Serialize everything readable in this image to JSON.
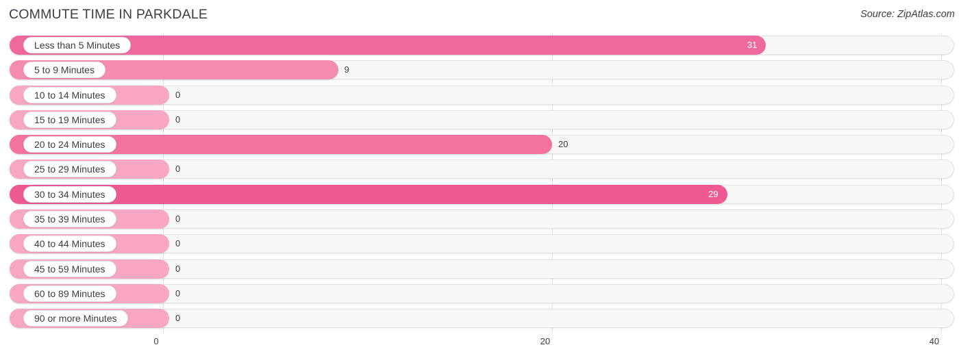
{
  "header": {
    "title": "COMMUTE TIME IN PARKDALE",
    "source": "Source: ZipAtlas.com"
  },
  "colors": {
    "bar_strong": "#ef6a9c",
    "bar_medium": "#f48cb2",
    "bar_light": "#f7a6c3",
    "track": "#f7f7f7",
    "gridline": "#dcdcdc",
    "value_inside": "#ffffff",
    "value_outside": "#3c3c46"
  },
  "chart_data": {
    "type": "bar",
    "orientation": "horizontal",
    "title": "COMMUTE TIME IN PARKDALE",
    "xlabel": "",
    "ylabel": "",
    "xlim": [
      0,
      40
    ],
    "xticks": [
      0,
      20,
      40
    ],
    "xtick_labels": [
      "0",
      "20",
      "40"
    ],
    "grid": true,
    "legend": false,
    "categories": [
      "Less than 5 Minutes",
      "5 to 9 Minutes",
      "10 to 14 Minutes",
      "15 to 19 Minutes",
      "20 to 24 Minutes",
      "25 to 29 Minutes",
      "30 to 34 Minutes",
      "35 to 39 Minutes",
      "40 to 44 Minutes",
      "45 to 59 Minutes",
      "60 to 89 Minutes",
      "90 or more Minutes"
    ],
    "values": [
      31,
      9,
      0,
      0,
      20,
      0,
      29,
      0,
      0,
      0,
      0,
      0
    ],
    "value_labels": [
      "31",
      "9",
      "0",
      "0",
      "20",
      "0",
      "29",
      "0",
      "0",
      "0",
      "0",
      "0"
    ]
  },
  "rows": [
    {
      "label": "Less than 5 Minutes",
      "value": 31,
      "value_label": "31",
      "label_inside": true,
      "color": "#ef6a9c"
    },
    {
      "label": "5 to 9 Minutes",
      "value": 9,
      "value_label": "9",
      "label_inside": false,
      "color": "#f48cb2"
    },
    {
      "label": "10 to 14 Minutes",
      "value": 0,
      "value_label": "0",
      "label_inside": false,
      "color": "#f7a6c3"
    },
    {
      "label": "15 to 19 Minutes",
      "value": 0,
      "value_label": "0",
      "label_inside": false,
      "color": "#f7a6c3"
    },
    {
      "label": "20 to 24 Minutes",
      "value": 20,
      "value_label": "20",
      "label_inside": false,
      "color": "#f2739f"
    },
    {
      "label": "25 to 29 Minutes",
      "value": 0,
      "value_label": "0",
      "label_inside": false,
      "color": "#f7a6c3"
    },
    {
      "label": "30 to 34 Minutes",
      "value": 29,
      "value_label": "29",
      "label_inside": true,
      "color": "#ed5b92"
    },
    {
      "label": "35 to 39 Minutes",
      "value": 0,
      "value_label": "0",
      "label_inside": false,
      "color": "#f7a6c3"
    },
    {
      "label": "40 to 44 Minutes",
      "value": 0,
      "value_label": "0",
      "label_inside": false,
      "color": "#f7a6c3"
    },
    {
      "label": "45 to 59 Minutes",
      "value": 0,
      "value_label": "0",
      "label_inside": false,
      "color": "#f7a6c3"
    },
    {
      "label": "60 to 89 Minutes",
      "value": 0,
      "value_label": "0",
      "label_inside": false,
      "color": "#f7a6c3"
    },
    {
      "label": "90 or more Minutes",
      "value": 0,
      "value_label": "0",
      "label_inside": false,
      "color": "#f7a6c3"
    }
  ],
  "axis": {
    "ticks": [
      {
        "label": "0",
        "value": 0
      },
      {
        "label": "20",
        "value": 20
      },
      {
        "label": "40",
        "value": 40
      }
    ]
  }
}
